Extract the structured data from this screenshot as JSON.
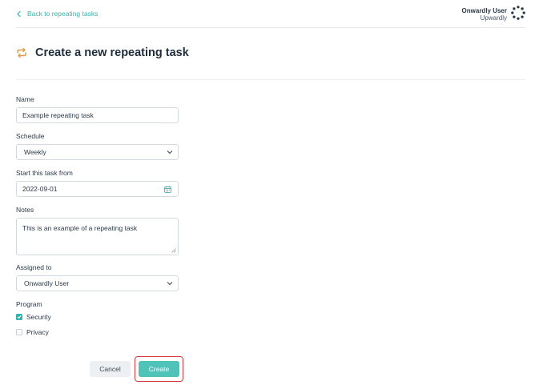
{
  "header": {
    "back_label": "Back to repeating tasks",
    "user_name": "Onwardly User",
    "user_org": "Upwardly"
  },
  "page": {
    "title": "Create a new repeating task"
  },
  "form": {
    "name_label": "Name",
    "name_value": "Example repeating task",
    "schedule_label": "Schedule",
    "schedule_value": "Weekly",
    "start_label": "Start this task from",
    "start_value": "2022-09-01",
    "notes_label": "Notes",
    "notes_value": "This is an example of a repeating task",
    "assigned_label": "Assigned to",
    "assigned_value": "Onwardly User",
    "program_label": "Program",
    "programs": [
      {
        "label": "Security",
        "checked": true
      },
      {
        "label": "Privacy",
        "checked": false
      }
    ]
  },
  "actions": {
    "cancel_label": "Cancel",
    "create_label": "Create"
  },
  "colors": {
    "accent": "#38b2ac",
    "primary_button": "#4fc3b8",
    "highlight": "#d23a3a",
    "repeat_icon": "#e29a4a"
  }
}
